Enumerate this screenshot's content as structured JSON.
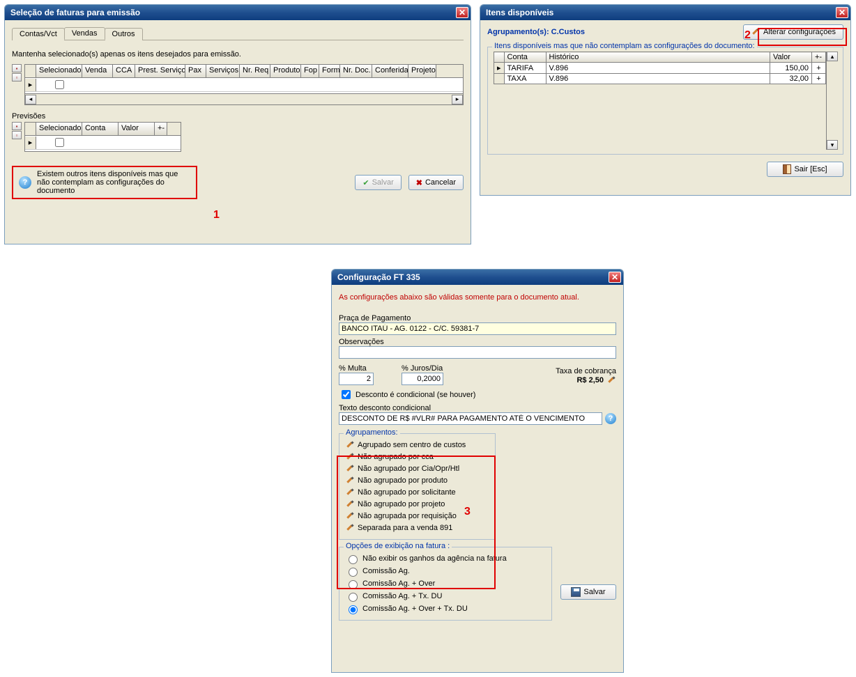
{
  "window1": {
    "title": "Seleção de faturas para emissão",
    "tabs": [
      "Contas/Vct",
      "Vendas",
      "Outros"
    ],
    "active_tab": 1,
    "note": "Mantenha selecionado(s) apenas os itens desejados para emissão.",
    "grid1_cols": [
      "Selecionado",
      "Venda",
      "CCA",
      "Prest. Serviços",
      "Pax",
      "Serviços",
      "Nr. Req",
      "Produto",
      "Fop",
      "Form",
      "Nr. Doc.",
      "Conferida",
      "Projeto"
    ],
    "previsoes_label": "Previsões",
    "grid2_cols": [
      "Selecionado",
      "Conta",
      "Valor",
      "+-"
    ],
    "info_text": "Existem outros itens disponíveis mas que não contemplam as configurações do documento",
    "btn_salvar": "Salvar",
    "btn_cancelar": "Cancelar",
    "annot": "1"
  },
  "window2": {
    "title": "Itens disponíveis",
    "agrup_label": "Agrupamento(s): C.Custos",
    "btn_alterar": "Alterar configurações",
    "fieldset_legend": "Itens disponíveis mas que não contemplam as configurações do documento:",
    "cols": [
      "Conta",
      "Histórico",
      "Valor",
      "+-"
    ],
    "rows": [
      {
        "conta": "TARIFA",
        "hist": "V.896",
        "valor": "150,00",
        "pm": "+"
      },
      {
        "conta": "TAXA",
        "hist": "V.896",
        "valor": "32,00",
        "pm": "+"
      }
    ],
    "btn_sair": "Sair [Esc]",
    "annot": "2"
  },
  "window3": {
    "title": "Configuração FT 335",
    "warn": "As configurações abaixo são válidas somente para o documento atual.",
    "lbl_praca": "Praça de Pagamento",
    "val_praca": "BANCO ITAÚ - AG. 0122 - C/C. 59381-7",
    "lbl_obs": "Observações",
    "val_obs": "",
    "lbl_multa": "% Multa",
    "val_multa": "2",
    "lbl_juros": "% Juros/Dia",
    "val_juros": "0,2000",
    "lbl_taxa": "Taxa de cobrança",
    "val_taxa": "R$ 2,50",
    "chk_desconto": "Desconto é condicional (se houver)",
    "lbl_texto_desc": "Texto desconto condicional",
    "val_texto_desc": "DESCONTO DE R$ #VLR# PARA PAGAMENTO ATÉ O VENCIMENTO",
    "agrup_title": "Agrupamentos:",
    "agrupamentos": [
      "Agrupado sem centro de custos",
      "Não agrupado por cca",
      "Não agrupado por Cia/Opr/Htl",
      "Não agrupado por produto",
      "Não agrupado por solicitante",
      "Não agrupado por projeto",
      "Não agrupada por requisição",
      "Separada para a venda 891"
    ],
    "opcoes_title": "Opções de exibição na fatura :",
    "opcoes": [
      "Não exibir os ganhos da agência na fatura",
      "Comissão Ag.",
      "Comissão Ag. + Over",
      "Comissão Ag. + Tx. DU",
      "Comissão Ag. + Over + Tx. DU"
    ],
    "selected_opcao": 4,
    "btn_salvar": "Salvar",
    "annot": "3"
  }
}
